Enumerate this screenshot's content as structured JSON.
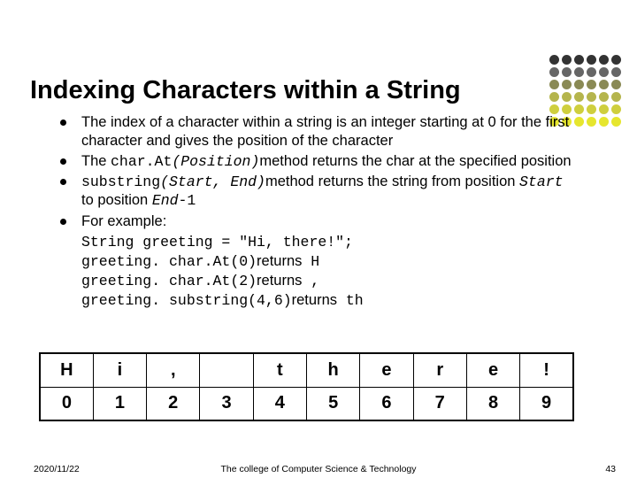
{
  "title": "Indexing Characters within a String",
  "bullets": {
    "b1": "The index of a character within a string is an integer starting at 0 for the first character and gives the position of the character",
    "b2_pre": "The ",
    "b2_code": "char.At",
    "b2_args": "(Position)",
    "b2_post": "method returns the char at the specified position",
    "b3_code": "substring",
    "b3_args": "(Start, End)",
    "b3_post_a": "method returns the string from position ",
    "b3_start": "Start",
    "b3_post_b": " to position ",
    "b3_end": "End",
    "b3_post_c": "-1",
    "b4": "For example:"
  },
  "example": {
    "l1": "String greeting = \"Hi, there!\";",
    "l2_a": "greeting. char.At(0)",
    "l2_b": "returns",
    "l2_c": " H",
    "l3_a": "greeting. char.At(2)",
    "l3_b": "returns",
    "l3_c": " ,",
    "l4_a": "greeting. substring(4,6)",
    "l4_b": "returns",
    "l4_c": " th"
  },
  "chart_data": {
    "type": "table",
    "rows": [
      [
        "H",
        "i",
        ",",
        "",
        "t",
        "h",
        "e",
        "r",
        "e",
        "!"
      ],
      [
        "0",
        "1",
        "2",
        "3",
        "4",
        "5",
        "6",
        "7",
        "8",
        "9"
      ]
    ]
  },
  "footer": {
    "date": "2020/11/22",
    "center": "The college of Computer Science & Technology",
    "page": "43"
  }
}
